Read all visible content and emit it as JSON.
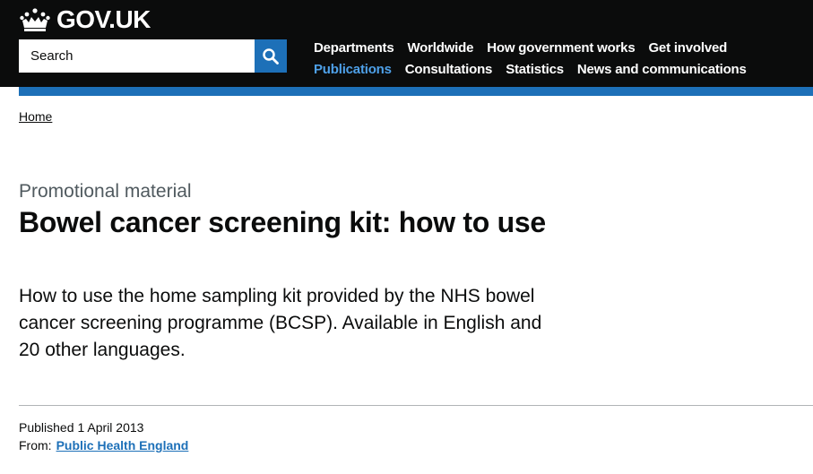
{
  "header": {
    "logo_text": "GOV.UK",
    "logo_icon": "crown-icon",
    "search": {
      "placeholder": "Search",
      "button_icon": "search-icon"
    },
    "nav_rows": [
      [
        {
          "label": "Departments",
          "active": false
        },
        {
          "label": "Worldwide",
          "active": false
        },
        {
          "label": "How government works",
          "active": false
        },
        {
          "label": "Get involved",
          "active": false
        }
      ],
      [
        {
          "label": "Publications",
          "active": true
        },
        {
          "label": "Consultations",
          "active": false
        },
        {
          "label": "Statistics",
          "active": false
        },
        {
          "label": "News and communications",
          "active": false
        }
      ]
    ]
  },
  "breadcrumb": {
    "home": "Home"
  },
  "page": {
    "document_type": "Promotional material",
    "title": "Bowel cancer screening kit: how to use",
    "summary": "How to use the home sampling kit provided by the NHS bowel cancer screening programme (BCSP). Available in English and 20 other languages."
  },
  "metadata": {
    "published_label": "Published",
    "published_date": "1 April 2013",
    "from_label": "From:",
    "from_org": "Public Health England"
  },
  "colors": {
    "header_bg": "#0b0c0c",
    "brand_blue": "#1d70b8",
    "active_nav": "#4ea0e8",
    "secondary_text": "#505a5f"
  }
}
